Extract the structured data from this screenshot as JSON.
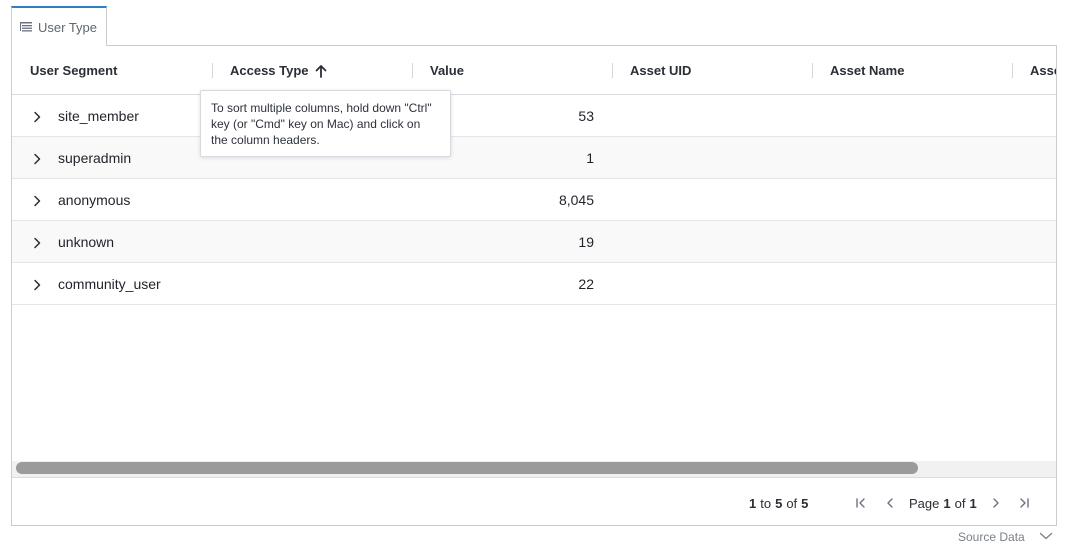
{
  "tab": {
    "label": "User Type",
    "icon": "tree-list-icon"
  },
  "columns": [
    "User Segment",
    "Access Type",
    "Value",
    "Asset UID",
    "Asset Name",
    "Asse"
  ],
  "sort": {
    "column": "Access Type",
    "direction": "ascending",
    "icon": "arrow-up-icon"
  },
  "tooltip": "To sort multiple columns, hold down \"Ctrl\" key (or \"Cmd\" key on Mac) and click on the column headers.",
  "rows": [
    {
      "segment": "site_member",
      "value": "53"
    },
    {
      "segment": "superadmin",
      "value": "1"
    },
    {
      "segment": "anonymous",
      "value": "8,045"
    },
    {
      "segment": "unknown",
      "value": "19"
    },
    {
      "segment": "community_user",
      "value": "22"
    }
  ],
  "pagination": {
    "from": "1",
    "to_word": "to",
    "to": "5",
    "of_word": "of",
    "total": "5",
    "page_word": "Page",
    "page": "1",
    "of_word2": "of",
    "pages": "1"
  },
  "footer_link": {
    "label": "Source Data",
    "icon": "chevron-down-icon"
  }
}
